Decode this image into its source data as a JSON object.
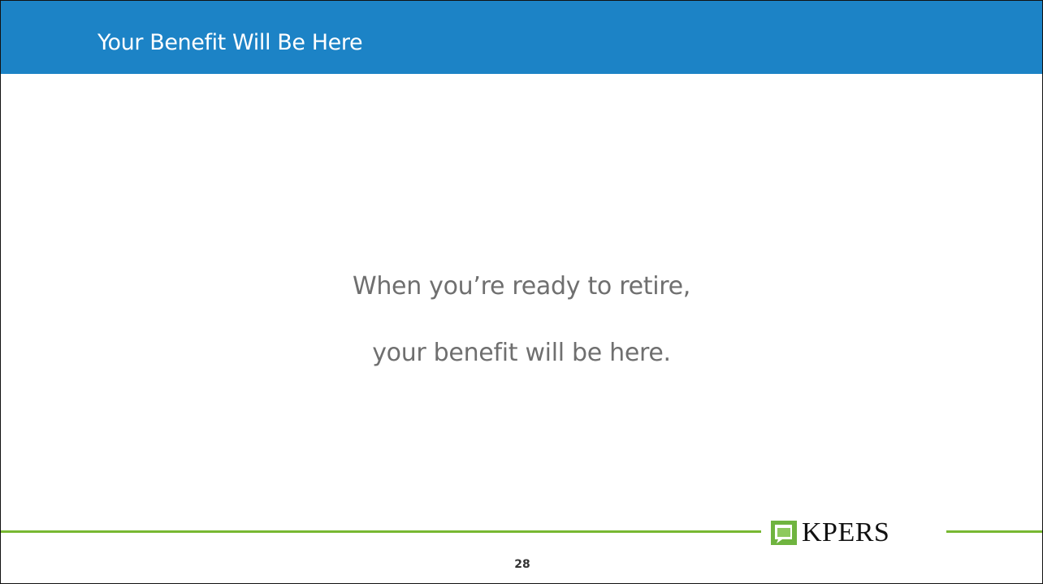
{
  "slide": {
    "title": "Your Benefit Will Be Here",
    "message_lines": [
      "When you’re ready to retire,",
      "your benefit will be here."
    ],
    "page_number": "28"
  },
  "logo": {
    "text": "KPERS",
    "icon": "kpers-leaf-icon"
  },
  "colors": {
    "header": "#1c83c6",
    "accent_rule": "#78b832",
    "message_text": "#6f6f6f"
  }
}
